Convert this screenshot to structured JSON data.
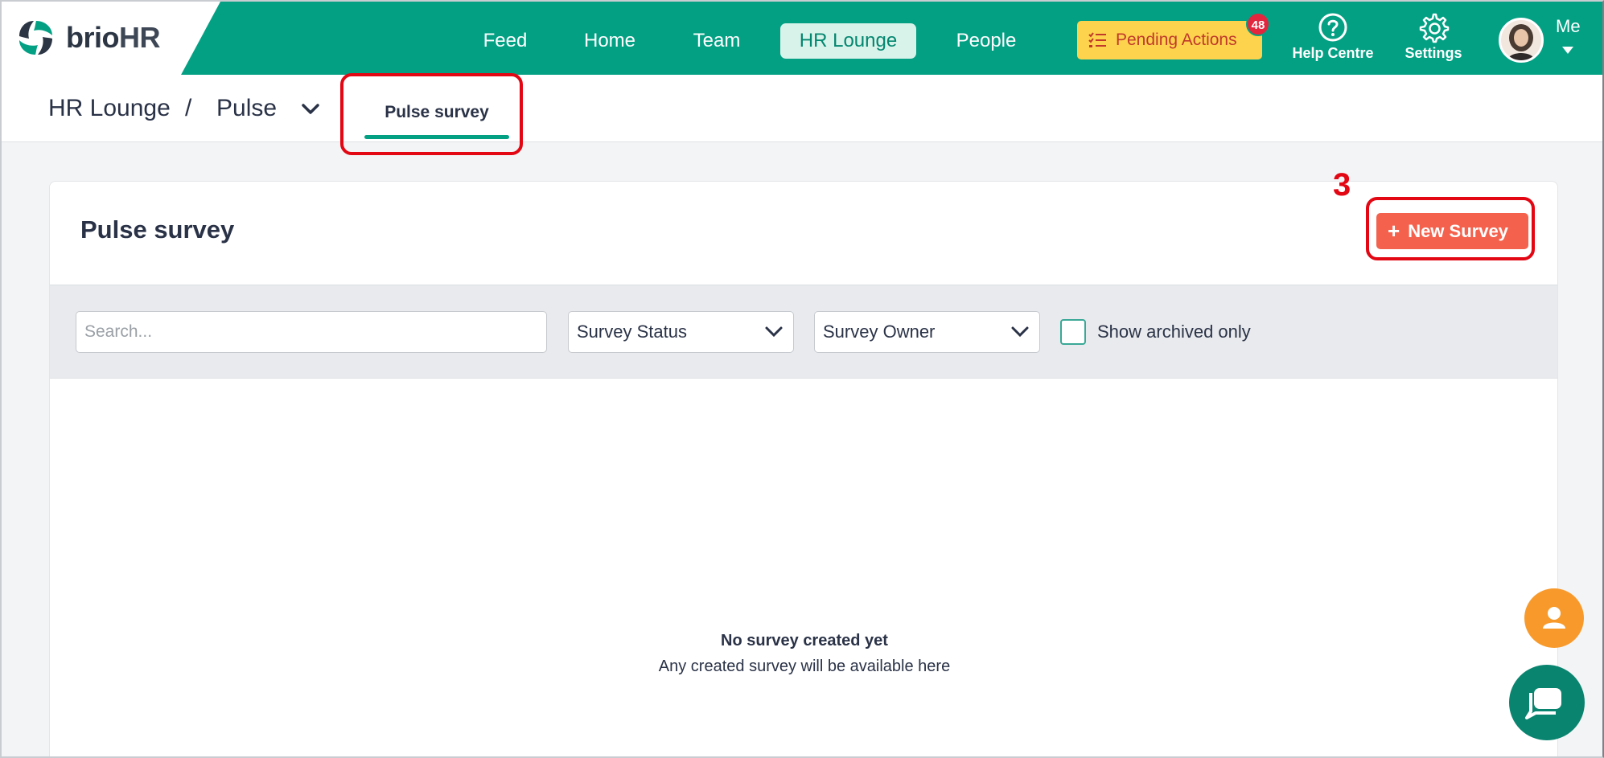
{
  "brand": {
    "name_left": "brio",
    "name_right": "HR"
  },
  "nav": {
    "items": [
      "Feed",
      "Home",
      "Team",
      "HR Lounge",
      "People"
    ],
    "active": "HR Lounge",
    "pending_label": "Pending Actions",
    "pending_count": "48",
    "help_label": "Help Centre",
    "settings_label": "Settings",
    "me_label": "Me"
  },
  "subheader": {
    "crumb_root": "HR Lounge",
    "crumb_sep": "/",
    "crumb_current": "Pulse",
    "tab_label": "Pulse survey"
  },
  "annotation": {
    "step_number": "3",
    "color": "#e30613"
  },
  "main": {
    "title": "Pulse survey",
    "new_button": "New Survey",
    "search_placeholder": "Search...",
    "status_select": "Survey Status",
    "owner_select": "Survey Owner",
    "archived_label": "Show archived only",
    "empty_title": "No survey created yet",
    "empty_subtitle": "Any created survey will be available here"
  },
  "colors": {
    "brand_green": "#03a084",
    "accent_coral": "#f4624e",
    "pending_yellow": "#fdd34e",
    "fab_orange": "#f79a2b",
    "chat_green": "#09846f"
  }
}
